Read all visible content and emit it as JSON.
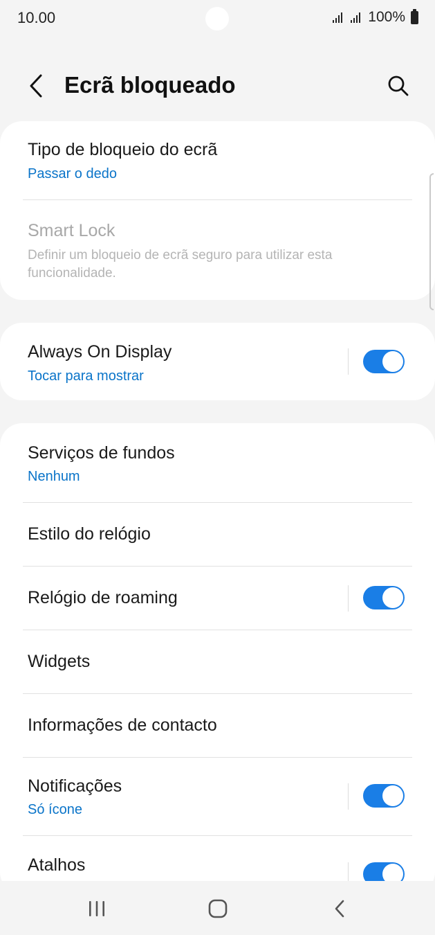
{
  "status_bar": {
    "time": "10.00",
    "battery": "100%"
  },
  "header": {
    "title": "Ecrã bloqueado",
    "back_icon": "chevron-left-icon",
    "search_icon": "search-icon"
  },
  "sections": {
    "lock": {
      "lock_type": {
        "title": "Tipo de bloqueio do ecrã",
        "value": "Passar o dedo"
      },
      "smart_lock": {
        "title": "Smart Lock",
        "description": "Definir um bloqueio de ecrã seguro para utilizar esta funcionalidade."
      }
    },
    "aod": {
      "title": "Always On Display",
      "value": "Tocar para mostrar",
      "enabled": true
    },
    "options": {
      "wallpaper_services": {
        "title": "Serviços de fundos",
        "value": "Nenhum"
      },
      "clock_style": {
        "title": "Estilo do relógio"
      },
      "roaming_clock": {
        "title": "Relógio de roaming",
        "enabled": true
      },
      "widgets": {
        "title": "Widgets"
      },
      "contact_info": {
        "title": "Informações de contacto"
      },
      "notifications": {
        "title": "Notificações",
        "value": "Só ícone",
        "enabled": true
      },
      "shortcuts": {
        "title": "Atalhos",
        "enabled": true
      }
    }
  },
  "nav_bar": {
    "recents_icon": "recents-icon",
    "home_icon": "home-icon",
    "back_icon": "back-icon"
  },
  "colors": {
    "accent": "#0a74c9",
    "toggle_on": "#1a7ee6",
    "background": "#f4f4f4",
    "card": "#ffffff"
  }
}
